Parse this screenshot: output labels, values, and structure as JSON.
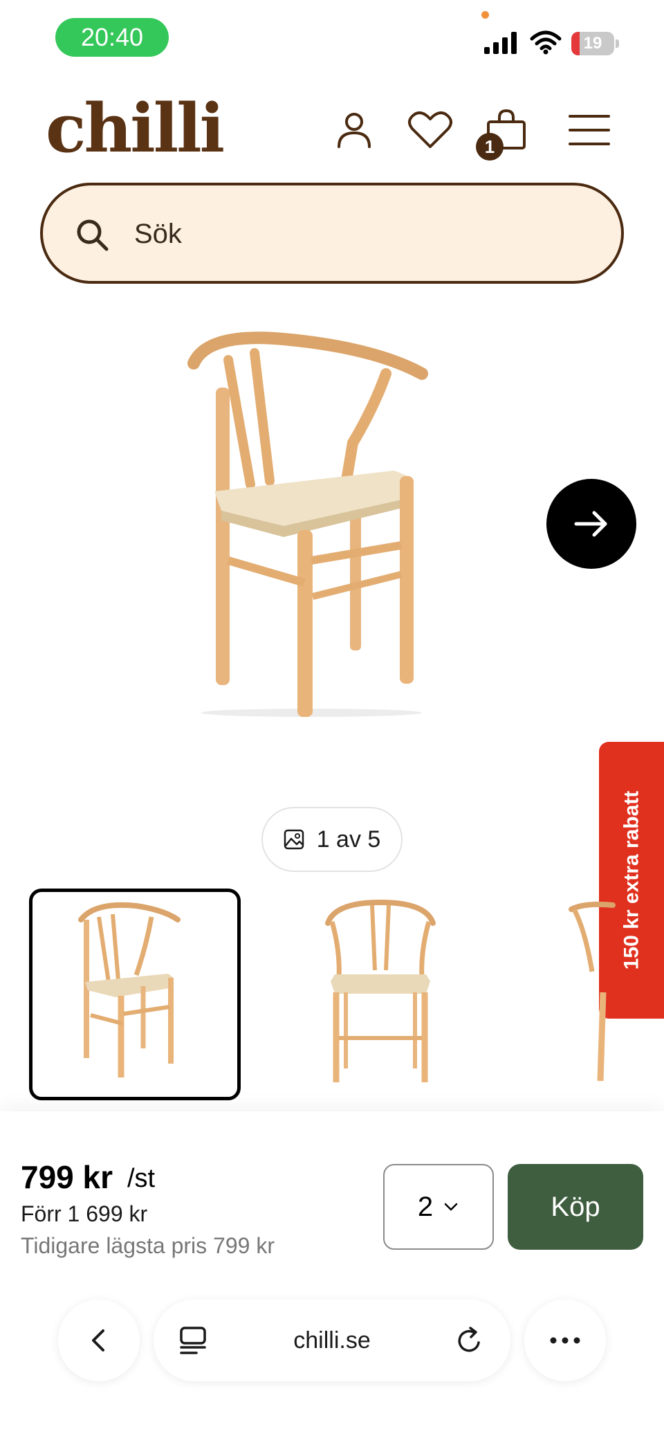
{
  "status_bar": {
    "time": "20:40",
    "battery_level": "19",
    "battery_fraction": 0.19,
    "icons": [
      "signal-icon",
      "wifi-icon",
      "battery-icon"
    ]
  },
  "header": {
    "logo": "chilli",
    "icons": [
      "account-icon",
      "heart-icon",
      "cart-icon",
      "menu-icon"
    ],
    "cart_count": "1"
  },
  "search": {
    "placeholder": "Sök"
  },
  "gallery": {
    "counter": "1 av 5",
    "current_index": 1,
    "total": 5,
    "thumbnails_visible": 3
  },
  "promo": {
    "label": "150 kr extra rabatt"
  },
  "purchase": {
    "price": "799 kr",
    "unit": "/st",
    "old_price": "Förr 1 699 kr",
    "lowest_price": "Tidigare lägsta pris 799 kr",
    "quantity": "2",
    "buy_label": "Köp"
  },
  "browser": {
    "url": "chilli.se"
  },
  "colors": {
    "brand_brown": "#5a3214",
    "search_bg": "#fdf0e1",
    "buy_green": "#3f5e3f",
    "promo_red": "#e0301e",
    "time_green": "#34c759"
  }
}
